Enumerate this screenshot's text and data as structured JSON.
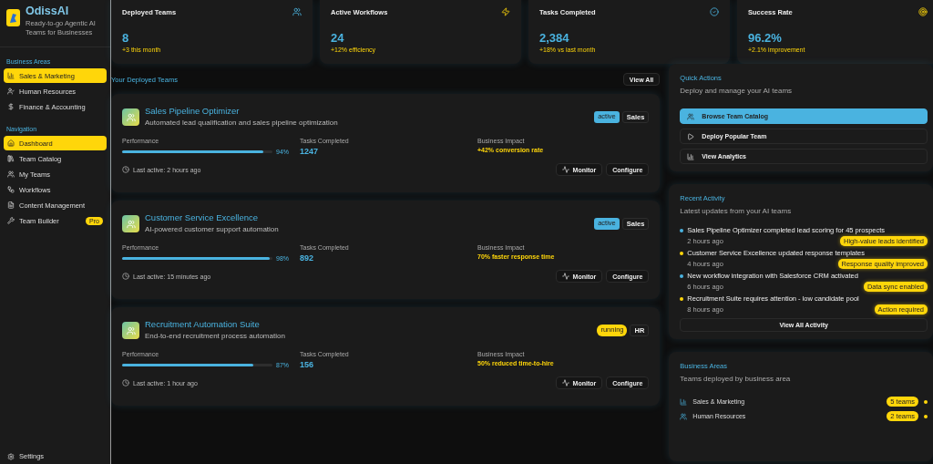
{
  "brand": {
    "name": "OdissAI",
    "tagline": "Ready-to-go Agentic AI Teams for Businesses"
  },
  "sidebar": {
    "sections": [
      {
        "title": "Business Areas",
        "items": [
          {
            "label": "Sales & Marketing",
            "selected": true
          },
          {
            "label": "Human Resources",
            "selected": false
          },
          {
            "label": "Finance & Accounting",
            "selected": false
          }
        ]
      },
      {
        "title": "Navigation",
        "items": [
          {
            "label": "Dashboard",
            "selected": true
          },
          {
            "label": "Team Catalog",
            "selected": false
          },
          {
            "label": "My Teams",
            "selected": false
          },
          {
            "label": "Workflows",
            "selected": false
          },
          {
            "label": "Content Management",
            "selected": false
          },
          {
            "label": "Team Builder",
            "selected": false,
            "badge": "Pro"
          }
        ]
      }
    ],
    "footer": {
      "label": "Settings"
    }
  },
  "stats": [
    {
      "title": "Deployed Teams",
      "value": "8",
      "note": "+3 this month"
    },
    {
      "title": "Active Workflows",
      "value": "24",
      "note": "+12% efficiency"
    },
    {
      "title": "Tasks Completed",
      "value": "2,384",
      "note": "+18% vs last month"
    },
    {
      "title": "Success Rate",
      "value": "96.2%",
      "note": "+2.1% improvement"
    }
  ],
  "teams_section": {
    "title": "Your Deployed Teams",
    "action": "View All"
  },
  "teams": [
    {
      "name": "Sales Pipeline Optimizer",
      "description": "Automated lead qualification and sales pipeline optimization",
      "status": "active",
      "area": "Sales",
      "performance_label": "Performance",
      "level": 0.94,
      "performance": "94%",
      "tasks_label": "Tasks Completed",
      "tasks": "1247",
      "impact_label": "Business Impact",
      "impact": "+42% conversion rate",
      "last_active": "Last active: 2 hours ago",
      "buttons": [
        "Monitor",
        "Configure"
      ]
    },
    {
      "name": "Customer Service Excellence",
      "description": "AI-powered customer support automation",
      "status": "active",
      "area": "Sales",
      "performance_label": "Performance",
      "level": 0.98,
      "performance": "98%",
      "tasks_label": "Tasks Completed",
      "tasks": "892",
      "impact_label": "Business Impact",
      "impact": "70% faster response time",
      "last_active": "Last active: 15 minutes ago",
      "buttons": [
        "Monitor",
        "Configure"
      ]
    },
    {
      "name": "Recruitment Automation Suite",
      "description": "End-to-end recruitment process automation",
      "status": "running",
      "area": "HR",
      "performance_label": "Performance",
      "level": 0.87,
      "performance": "87%",
      "tasks_label": "Tasks Completed",
      "tasks": "156",
      "impact_label": "Business Impact",
      "impact": "50% reduced time-to-hire",
      "last_active": "Last active: 1 hour ago",
      "buttons": [
        "Monitor",
        "Configure"
      ]
    }
  ],
  "quick_actions": {
    "title": "Quick Actions",
    "subtitle": "Deploy and manage your AI teams",
    "items": [
      {
        "label": "Browse Team Catalog",
        "selected": true
      },
      {
        "label": "Deploy Popular Team",
        "selected": false
      },
      {
        "label": "View Analytics",
        "selected": false
      }
    ]
  },
  "recent_activity": {
    "title": "Recent Activity",
    "subtitle": "Latest updates from your AI teams",
    "items": [
      {
        "text": "Sales Pipeline Optimizer completed lead scoring for 45 prospects",
        "time": "2 hours ago",
        "tag": "High-value leads identified",
        "color": "#4ab3e0"
      },
      {
        "text": "Customer Service Excellence updated response templates",
        "time": "4 hours ago",
        "tag": "Response quality improved",
        "color": "#ffd60a"
      },
      {
        "text": "New workflow integration with Salesforce CRM activated",
        "time": "6 hours ago",
        "tag": "Data sync enabled",
        "color": "#4ab3e0"
      },
      {
        "text": "Recruitment Suite requires attention - low candidate pool",
        "time": "8 hours ago",
        "tag": "Action required",
        "color": "#ffd60a"
      }
    ],
    "action": "View All Activity"
  },
  "business_areas": {
    "title": "Business Areas",
    "subtitle": "Teams deployed by business area",
    "items": [
      {
        "label": "Sales & Marketing",
        "count": "5 teams",
        "color": "#ffd60a"
      },
      {
        "label": "Human Resources",
        "count": "2 teams",
        "color": "#ffd60a"
      }
    ]
  }
}
